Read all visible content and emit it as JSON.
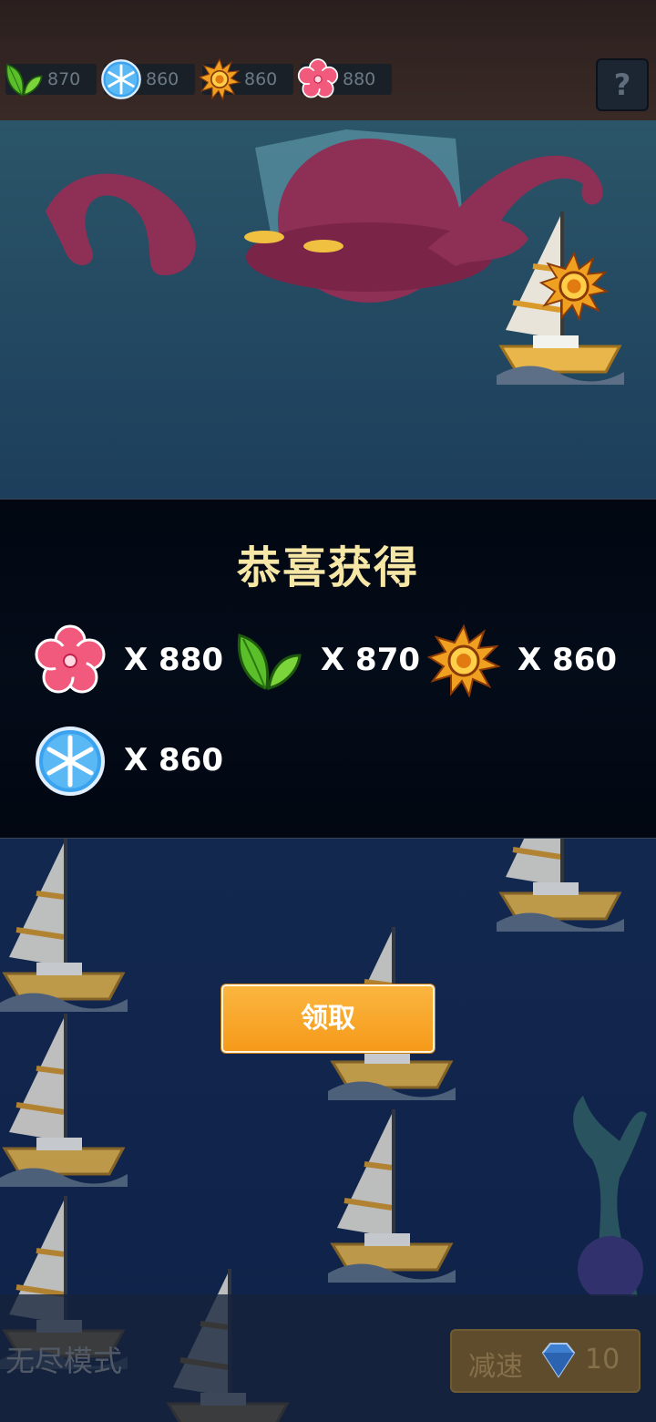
{
  "resources": [
    {
      "icon": "leaf-icon",
      "value": "870"
    },
    {
      "icon": "snowflake-icon",
      "value": "860"
    },
    {
      "icon": "sun-icon",
      "value": "860"
    },
    {
      "icon": "blossom-icon",
      "value": "880"
    }
  ],
  "help": {
    "label": "?"
  },
  "dialog": {
    "title": "恭喜获得",
    "rewards": [
      {
        "icon": "blossom-icon",
        "text": "X 880"
      },
      {
        "icon": "leaf-icon",
        "text": "X 870"
      },
      {
        "icon": "sun-icon",
        "text": "X 860"
      },
      {
        "icon": "snowflake-icon",
        "text": "X 860"
      }
    ],
    "claim_label": "领取"
  },
  "bottom": {
    "mode_label": "无尽模式",
    "slow_label": "减速",
    "slow_cost": "10"
  },
  "colors": {
    "title": "#f6e7a6",
    "claim": "#f7a623"
  }
}
